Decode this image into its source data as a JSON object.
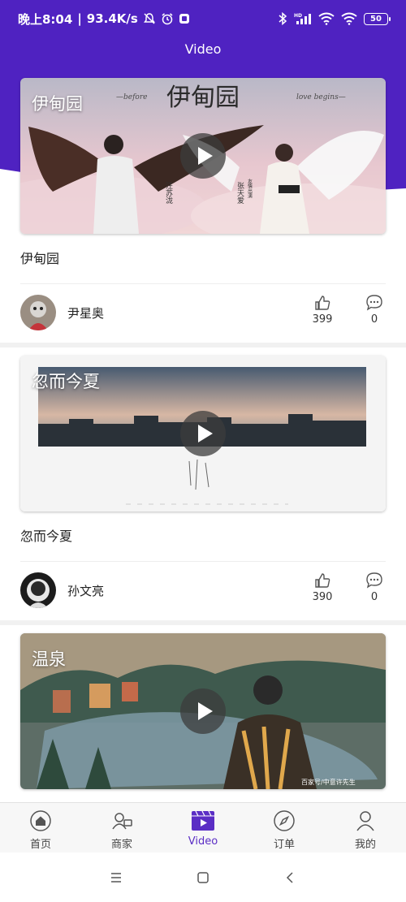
{
  "colors": {
    "brand": "#4f22c1",
    "accent": "#5b2ec5",
    "tab_text": "#444444"
  },
  "status_bar": {
    "time": "晚上8:04",
    "network_speed": "93.4K/s",
    "left_icons": [
      "mute-icon",
      "alarm-icon",
      "app-notification-icon"
    ],
    "right_icons": [
      "bluetooth-icon",
      "signal-hd-icon",
      "wifi-icon",
      "wifi-icon"
    ],
    "battery": "50"
  },
  "header": {
    "title": "Video"
  },
  "videos": [
    {
      "overlay_title": "伊甸园",
      "title": "伊甸园",
      "author": "尹星奥",
      "likes": "399",
      "comments": "0"
    },
    {
      "overlay_title": "忽而今夏",
      "title": "忽而今夏",
      "author": "孙文亮",
      "likes": "390",
      "comments": "0"
    },
    {
      "overlay_title": "温泉"
    }
  ],
  "thumb_text": {
    "v1_before": "—before",
    "v1_big": "伊甸园",
    "v1_love": "love begins—",
    "v1_credit_left": "汪苏泷",
    "v1_credit_right": "张天爱",
    "v1_credit_small": "友情出演",
    "v3_watermark": "百家号/中意许先生"
  },
  "tab_bar": {
    "items": [
      {
        "label": "首页",
        "icon": "home-icon"
      },
      {
        "label": "商家",
        "icon": "merchant-icon"
      },
      {
        "label": "Video",
        "icon": "video-icon",
        "active": true
      },
      {
        "label": "订单",
        "icon": "compass-icon"
      },
      {
        "label": "我的",
        "icon": "user-icon"
      }
    ]
  },
  "system_nav": {
    "icons": [
      "menu-icon",
      "home-square-icon",
      "back-icon"
    ]
  }
}
